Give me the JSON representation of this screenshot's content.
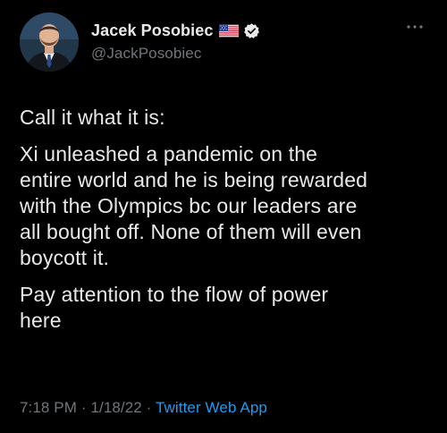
{
  "author": {
    "display_name": "Jacek Posobiec",
    "handle": "@JackPosobiec",
    "flag_icon": "us-flag-icon",
    "verified_icon": "verified-badge-icon",
    "verified_color": "#e7e9ea"
  },
  "menu": {
    "more_icon": "more-dots-icon"
  },
  "tweet": {
    "paragraphs": [
      "Call it what it is:",
      "Xi unleashed a pandemic on the\nentire world and he is being rewarded\nwith the Olympics bc our leaders are\nall bought off. None of them will even\nboycott it.",
      "Pay attention to the flow of power\nhere"
    ]
  },
  "meta": {
    "time": "7:18 PM",
    "separator1": " · ",
    "date": "1/18/22",
    "separator2": " · ",
    "source": "Twitter Web App"
  },
  "colors": {
    "background": "#000000",
    "text_primary": "#e7e9ea",
    "text_secondary": "#71767b",
    "link": "#1d9bf0"
  }
}
